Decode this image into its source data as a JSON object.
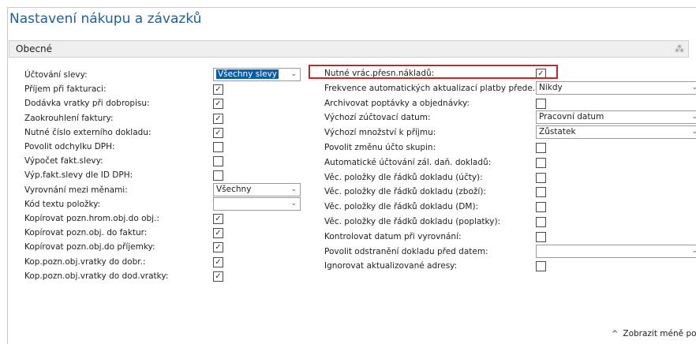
{
  "page": {
    "title": "Nastavení nákupu a závazků"
  },
  "section": {
    "title": "Obecné",
    "icon": "pin-icon"
  },
  "left_fields": [
    {
      "label": "Účtování slevy:",
      "type": "select",
      "value": "Všechny slevy",
      "selected_text": true
    },
    {
      "label": "Příjem při fakturaci:",
      "type": "checkbox",
      "checked": true,
      "mark": "✓"
    },
    {
      "label": "Dodávka vratky při dobropisu:",
      "type": "checkbox",
      "checked": true,
      "mark": "✓"
    },
    {
      "label": "Zaokrouhlení faktury:",
      "type": "checkbox",
      "checked": true,
      "mark": "✓"
    },
    {
      "label": "Nutné číslo externího dokladu:",
      "type": "checkbox",
      "checked": true,
      "mark": "✓"
    },
    {
      "label": "Povolit odchylku DPH:",
      "type": "checkbox",
      "checked": false,
      "mark": ""
    },
    {
      "label": "Výpočet fakt.slevy:",
      "type": "checkbox",
      "checked": false,
      "mark": ""
    },
    {
      "label": "Výp.fakt.slevy dle ID DPH:",
      "type": "checkbox",
      "checked": false,
      "mark": ""
    },
    {
      "label": "Vyrovnání mezi měnami:",
      "type": "select",
      "value": "Všechny"
    },
    {
      "label": "Kód textu položky:",
      "type": "select",
      "value": ""
    },
    {
      "label": "Kopírovat pozn.hrom.obj.do obj.:",
      "type": "checkbox",
      "checked": true,
      "mark": "✓"
    },
    {
      "label": "Kopírovat pozn.obj. do faktur:",
      "type": "checkbox",
      "checked": true,
      "mark": "✓"
    },
    {
      "label": "Kopírovat pozn.obj.do příjemky:",
      "type": "checkbox",
      "checked": true,
      "mark": "✓"
    },
    {
      "label": "Kop.pozn.obj.vratky do dobr.:",
      "type": "checkbox",
      "checked": true,
      "mark": "✓"
    },
    {
      "label": "Kop.pozn.obj.vratky do dod.vratky:",
      "type": "checkbox",
      "checked": true,
      "mark": "✓"
    }
  ],
  "right_fields": [
    {
      "label": "Nutné vrác.přesn.nákladů:",
      "type": "checkbox",
      "checked": true,
      "mark": "✓"
    },
    {
      "label": "Frekvence automatických aktualizací platby přede...",
      "type": "select",
      "value": "Nikdy"
    },
    {
      "label": "Archivovat poptávky a objednávky:",
      "type": "checkbox",
      "checked": false,
      "mark": ""
    },
    {
      "label": "Výchozí zúčtovací datum:",
      "type": "select",
      "value": "Pracovní datum"
    },
    {
      "label": "Výchozí množství k příjmu:",
      "type": "select",
      "value": "Zůstatek"
    },
    {
      "label": "Povolit změnu účto skupin:",
      "type": "checkbox",
      "checked": false,
      "mark": ""
    },
    {
      "label": "Automatické účtování zál. daň. dokladů:",
      "type": "checkbox",
      "checked": false,
      "mark": ""
    },
    {
      "label": "Věc. položky dle řádků dokladu (účty):",
      "type": "checkbox",
      "checked": false,
      "mark": ""
    },
    {
      "label": "Věc. položky dle řádků dokladu (zboží):",
      "type": "checkbox",
      "checked": false,
      "mark": ""
    },
    {
      "label": "Věc. položky dle řádků dokladu (DM):",
      "type": "checkbox",
      "checked": false,
      "mark": ""
    },
    {
      "label": "Věc. položky dle řádků dokladu (poplatky):",
      "type": "checkbox",
      "checked": false,
      "mark": ""
    },
    {
      "label": "Kontrolovat datum při vyrovnání:",
      "type": "checkbox",
      "checked": false,
      "mark": ""
    },
    {
      "label": "Povolit odstranění dokladu před datem:",
      "type": "select",
      "value": ""
    },
    {
      "label": "Ignorovat aktualizované adresy:",
      "type": "checkbox",
      "checked": false,
      "mark": ""
    }
  ],
  "footer": {
    "show_less_label": "Zobrazit méně po",
    "caret": "^"
  },
  "colors": {
    "title": "#1f5f9a",
    "highlight_border": "#c0272d",
    "selection": "#0b5ca8"
  }
}
